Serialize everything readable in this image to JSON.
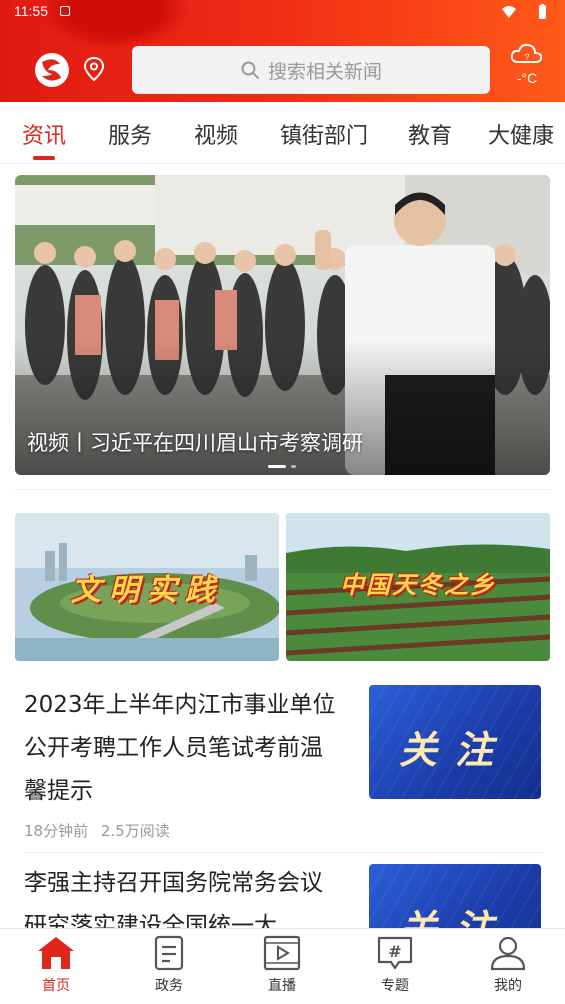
{
  "status_bar": {
    "time": "11:55"
  },
  "header": {
    "search_placeholder": "搜索相关新闻",
    "weather_temp": "-°C",
    "colors": {
      "brand_red": "#e0251b",
      "header_orange": "#ff5a18"
    }
  },
  "tabs": [
    {
      "label": "资讯",
      "active": true
    },
    {
      "label": "服务"
    },
    {
      "label": "视频"
    },
    {
      "label": "镇街部门"
    },
    {
      "label": "教育"
    },
    {
      "label": "大健康"
    }
  ],
  "banner": {
    "caption": "视频丨习近平在四川眉山市考察调研"
  },
  "promos": [
    {
      "text": "文明实践"
    },
    {
      "text": "中国天冬之乡"
    }
  ],
  "news": [
    {
      "title": "2023年上半年内江市事业单位公开考聘工作人员笔试考前温馨提示",
      "time": "18分钟前",
      "reads": "2.5万阅读",
      "thumb_text": "关注"
    },
    {
      "title": "李强主持召开国务院常务会议 研究落实建设全国统一大",
      "thumb_text": "关注"
    }
  ],
  "bottom_nav": [
    {
      "label": "首页",
      "icon": "home-icon",
      "active": true
    },
    {
      "label": "政务",
      "icon": "document-icon"
    },
    {
      "label": "直播",
      "icon": "live-video-icon"
    },
    {
      "label": "专题",
      "icon": "hashtag-topic-icon"
    },
    {
      "label": "我的",
      "icon": "profile-icon"
    }
  ]
}
